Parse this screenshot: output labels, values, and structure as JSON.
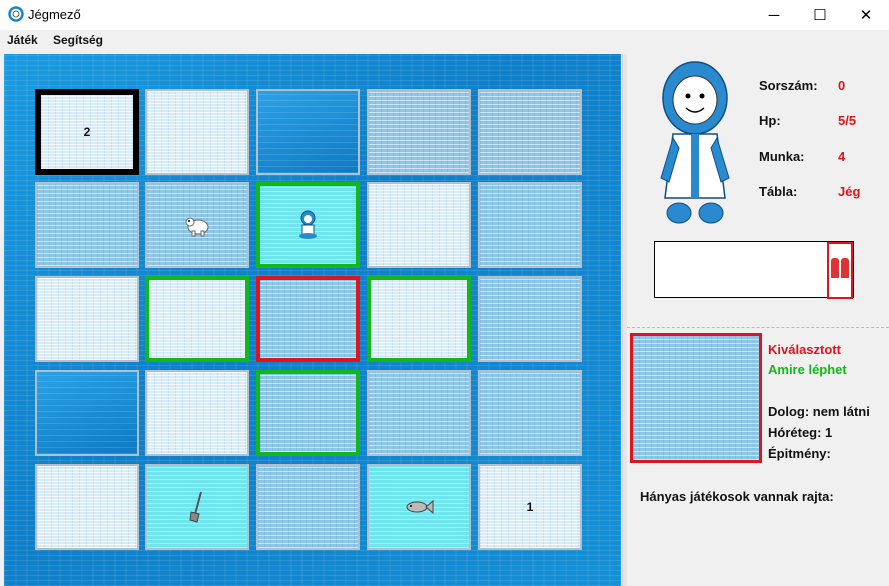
{
  "window": {
    "title": "Jégmező",
    "minimize": "─",
    "maximize": "☐",
    "close": "✕"
  },
  "menu": {
    "items": [
      "Játék",
      "Segítség"
    ]
  },
  "board": {
    "tiles": [
      {
        "type": "ice-light",
        "label": "2",
        "highlight": "black"
      },
      {
        "type": "ice-light",
        "label": ""
      },
      {
        "type": "hole",
        "label": ""
      },
      {
        "type": "ice-dense",
        "label": ""
      },
      {
        "type": "ice-dense",
        "label": ""
      },
      {
        "type": "ice-dense",
        "label": ""
      },
      {
        "type": "ice-dense",
        "label": "",
        "item": "polar-bear"
      },
      {
        "type": "cyan",
        "label": "",
        "highlight": "green",
        "item": "eskimo-player"
      },
      {
        "type": "ice-light",
        "label": ""
      },
      {
        "type": "ice-dense",
        "label": ""
      },
      {
        "type": "ice-light",
        "label": ""
      },
      {
        "type": "ice-light",
        "label": "",
        "highlight": "green"
      },
      {
        "type": "ice-dense",
        "label": "",
        "highlight": "red"
      },
      {
        "type": "ice-light",
        "label": "",
        "highlight": "green"
      },
      {
        "type": "ice-dense",
        "label": ""
      },
      {
        "type": "hole",
        "label": ""
      },
      {
        "type": "ice-light",
        "label": ""
      },
      {
        "type": "ice-dense",
        "label": "",
        "highlight": "green"
      },
      {
        "type": "ice-dense",
        "label": ""
      },
      {
        "type": "ice-dense",
        "label": ""
      },
      {
        "type": "ice-light",
        "label": ""
      },
      {
        "type": "cyan",
        "label": "",
        "item": "shovel"
      },
      {
        "type": "ice-dense",
        "label": ""
      },
      {
        "type": "cyan",
        "label": "",
        "item": "fish"
      },
      {
        "type": "ice-light",
        "label": "1"
      }
    ]
  },
  "player": {
    "stats": [
      {
        "label": "Sorszám:",
        "value": "0"
      },
      {
        "label": "Hp:",
        "value": "5/5"
      },
      {
        "label": "Munka:",
        "value": "4"
      },
      {
        "label": "Tábla:",
        "value": "Jég"
      }
    ],
    "inventory_item": "gloves-icon"
  },
  "selected": {
    "legend_selected": "Kiválasztott",
    "legend_movable": "Amire léphet",
    "thing": "Dolog: nem látni",
    "snow": "Hóréteg: 1",
    "building": "Épitmény:",
    "players_on": "Hányas játékosok vannak rajta:"
  },
  "colors": {
    "selected": "#e0141c",
    "movable": "#12b81a",
    "current": "#000000"
  }
}
